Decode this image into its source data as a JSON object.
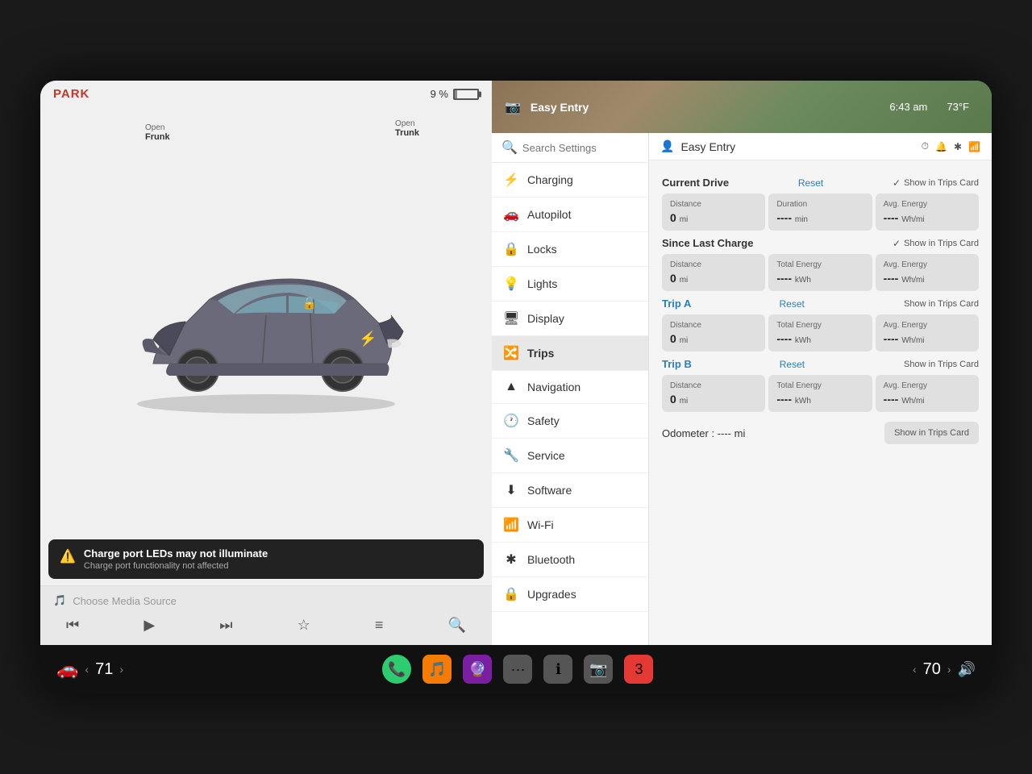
{
  "screen": {
    "left_panel": {
      "park_label": "PARK",
      "battery_percent": "9 %",
      "frunk": {
        "open_label": "Open",
        "label": "Frunk"
      },
      "trunk": {
        "open_label": "Open",
        "label": "Trunk"
      },
      "warning": {
        "icon": "⚠",
        "title": "Charge port LEDs may not illuminate",
        "subtitle": "Charge port functionality not affected"
      },
      "media": {
        "source_placeholder": "Choose Media Source"
      }
    },
    "map_header": {
      "icon": "📷",
      "title": "Easy Entry",
      "time": "6:43 am",
      "temp": "73°F"
    },
    "profile": {
      "icon": "👤",
      "name": "Easy Entry",
      "status_icons": [
        "🔔",
        "❄",
        "📶"
      ]
    },
    "search": {
      "placeholder": "Search Settings"
    },
    "settings_menu": [
      {
        "icon": "⚡",
        "label": "Charging"
      },
      {
        "icon": "🚗",
        "label": "Autopilot"
      },
      {
        "icon": "🔒",
        "label": "Locks"
      },
      {
        "icon": "💡",
        "label": "Lights"
      },
      {
        "icon": "🖥",
        "label": "Display"
      },
      {
        "icon": "🔀",
        "label": "Trips",
        "active": true
      },
      {
        "icon": "▲",
        "label": "Navigation"
      },
      {
        "icon": "🕐",
        "label": "Safety"
      },
      {
        "icon": "🔧",
        "label": "Service"
      },
      {
        "icon": "⬇",
        "label": "Software"
      },
      {
        "icon": "📶",
        "label": "Wi-Fi"
      },
      {
        "icon": "✱",
        "label": "Bluetooth"
      },
      {
        "icon": "🔒",
        "label": "Upgrades"
      }
    ],
    "trips": {
      "current_drive": {
        "title": "Current Drive",
        "reset_label": "Reset",
        "show_in_trips": true,
        "show_in_trips_label": "Show in Trips Card",
        "distance": {
          "label": "Distance",
          "value": "0",
          "unit": "mi"
        },
        "duration": {
          "label": "Duration",
          "value": "----",
          "unit": "min"
        },
        "avg_energy": {
          "label": "Avg. Energy",
          "value": "----",
          "unit": "Wh/mi"
        }
      },
      "since_last_charge": {
        "title": "Since Last Charge",
        "show_in_trips": true,
        "show_in_trips_label": "Show in Trips Card",
        "distance": {
          "label": "Distance",
          "value": "0",
          "unit": "mi"
        },
        "total_energy": {
          "label": "Total Energy",
          "value": "----",
          "unit": "kWh"
        },
        "avg_energy": {
          "label": "Avg. Energy",
          "value": "----",
          "unit": "Wh/mi"
        }
      },
      "trip_a": {
        "title": "Trip A",
        "reset_label": "Reset",
        "show_in_trips": false,
        "show_in_trips_label": "Show in Trips Card",
        "distance": {
          "label": "Distance",
          "value": "0",
          "unit": "mi"
        },
        "total_energy": {
          "label": "Total Energy",
          "value": "----",
          "unit": "kWh"
        },
        "avg_energy": {
          "label": "Avg. Energy",
          "value": "----",
          "unit": "Wh/mi"
        }
      },
      "trip_b": {
        "title": "Trip B",
        "reset_label": "Reset",
        "show_in_trips": false,
        "show_in_trips_label": "Show in Trips Card",
        "distance": {
          "label": "Distance",
          "value": "0",
          "unit": "mi"
        },
        "total_energy": {
          "label": "Total Energy",
          "value": "----",
          "unit": "kWh"
        },
        "avg_energy": {
          "label": "Avg. Energy",
          "value": "----",
          "unit": "Wh/mi"
        }
      },
      "odometer": {
        "label": "Odometer",
        "value": "----",
        "unit": "mi",
        "show_in_trips_label": "Show in Trips Card"
      }
    },
    "taskbar": {
      "left_temp": "71",
      "right_temp": "70",
      "apps": [
        {
          "icon": "📞",
          "type": "phone"
        },
        {
          "icon": "🎵",
          "type": "orange"
        },
        {
          "icon": "🔮",
          "type": "purple"
        },
        {
          "icon": "···",
          "type": "gray"
        },
        {
          "icon": "ℹ",
          "type": "gray"
        },
        {
          "icon": "📷",
          "type": "gray"
        },
        {
          "icon": "3",
          "type": "red"
        }
      ]
    }
  }
}
